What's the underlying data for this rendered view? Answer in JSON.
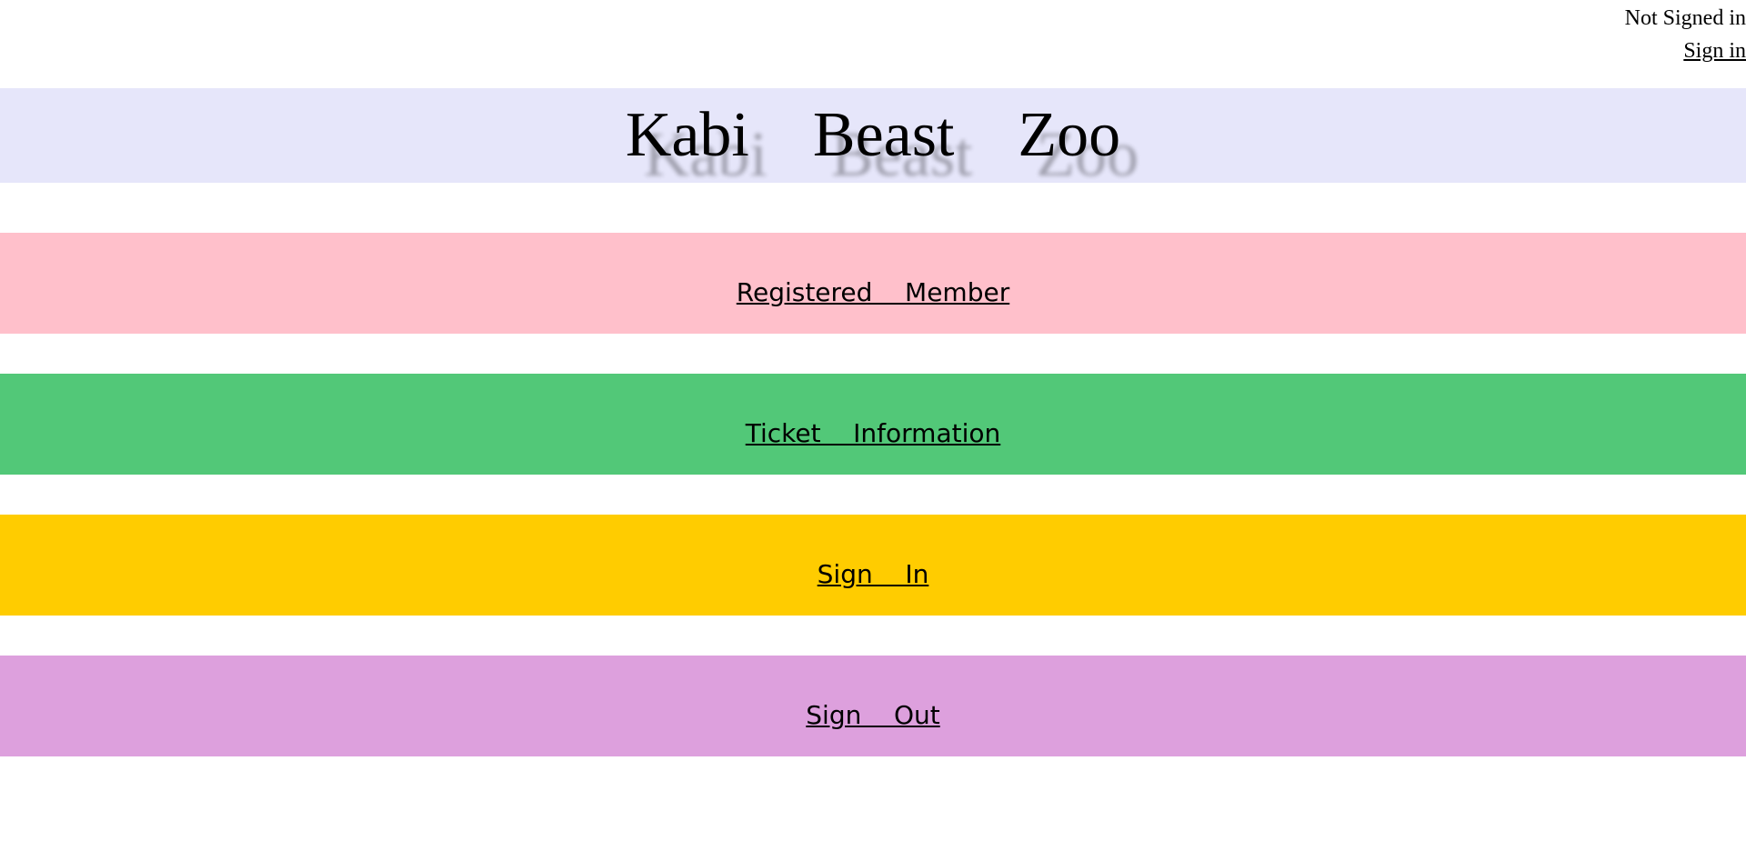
{
  "header": {
    "status_text": "Not Signed in",
    "sign_in_link": "Sign in"
  },
  "banner": {
    "title": "Kabi    Beast    Zoo",
    "background": "#e6e6fa"
  },
  "nav": [
    {
      "label": "Registered    Member",
      "color": "#ffc0cb"
    },
    {
      "label": "Ticket    Information",
      "color": "#52c878"
    },
    {
      "label": "Sign    In",
      "color": "#ffcc00"
    },
    {
      "label": "Sign    Out",
      "color": "#dda0dd"
    }
  ]
}
